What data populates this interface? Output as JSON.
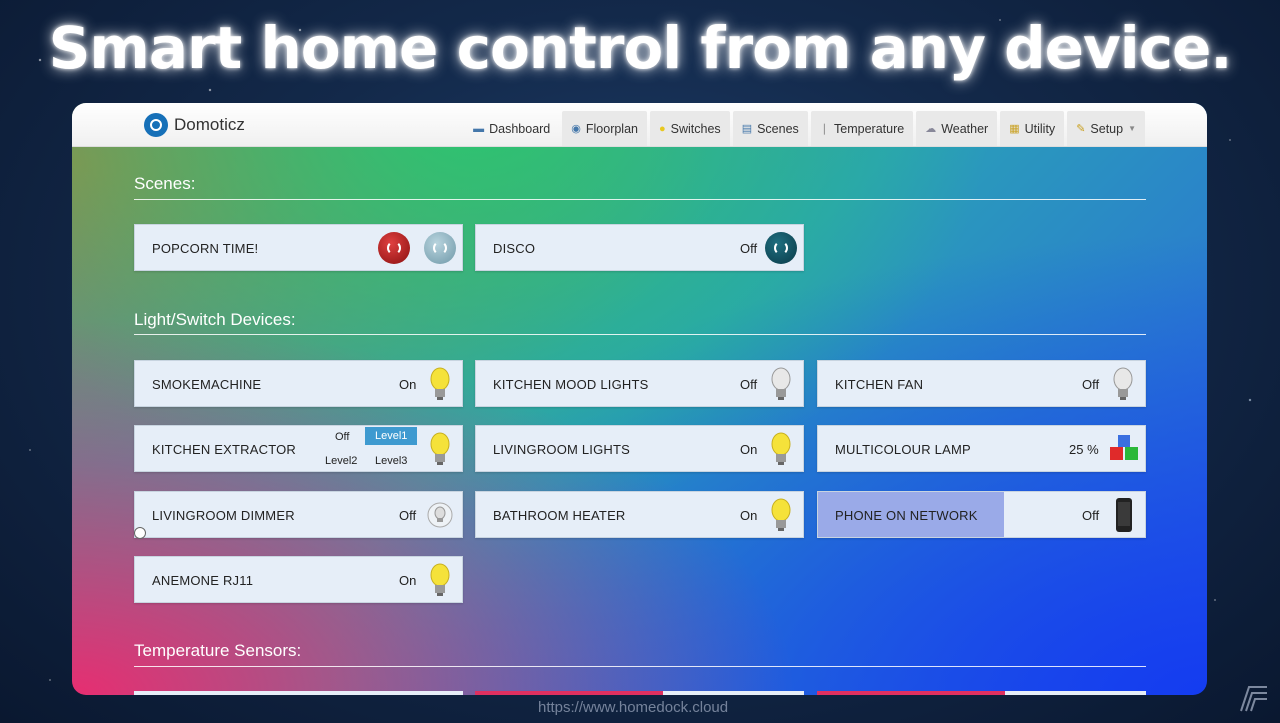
{
  "headline": "Smart home control from any device.",
  "app": {
    "brand": "Domoticz",
    "nav": [
      {
        "label": "Dashboard",
        "icon": "monitor-icon"
      },
      {
        "label": "Floorplan",
        "icon": "floorplan-icon"
      },
      {
        "label": "Switches",
        "icon": "bulb-icon"
      },
      {
        "label": "Scenes",
        "icon": "clapperboard-icon"
      },
      {
        "label": "Temperature",
        "icon": "thermometer-icon"
      },
      {
        "label": "Weather",
        "icon": "cloud-icon"
      },
      {
        "label": "Utility",
        "icon": "utility-icon"
      },
      {
        "label": "Setup",
        "icon": "wrench-icon"
      }
    ],
    "sections": {
      "scenes": "Scenes:",
      "lights": "Light/Switch Devices:",
      "temperature": "Temperature Sensors:"
    },
    "scenes": [
      {
        "name": "POPCORN TIME!",
        "status": ""
      },
      {
        "name": "DISCO",
        "status": "Off"
      }
    ],
    "devices": [
      {
        "name": "SMOKEMACHINE",
        "status": "On"
      },
      {
        "name": "KITCHEN MOOD LIGHTS",
        "status": "Off"
      },
      {
        "name": "KITCHEN FAN",
        "status": "Off"
      },
      {
        "name": "KITCHEN EXTRACTOR",
        "levels": [
          "Off",
          "Level1",
          "Level2",
          "Level3"
        ],
        "selected": "Level1"
      },
      {
        "name": "LIVINGROOM LIGHTS",
        "status": "On"
      },
      {
        "name": "MULTICOLOUR LAMP",
        "status": "25 %"
      },
      {
        "name": "LIVINGROOM DIMMER",
        "status": "Off"
      },
      {
        "name": "BATHROOM HEATER",
        "status": "On"
      },
      {
        "name": "PHONE ON NETWORK",
        "status": "Off"
      },
      {
        "name": "ANEMONE RJ11",
        "status": "On"
      }
    ]
  },
  "watermark": "https://www.homedock.cloud",
  "colors": {
    "accent": "#3e9ad0",
    "on_bulb": "#f5e23a",
    "off_bulb": "#d8d8d8",
    "scene_red": "#b01818"
  }
}
